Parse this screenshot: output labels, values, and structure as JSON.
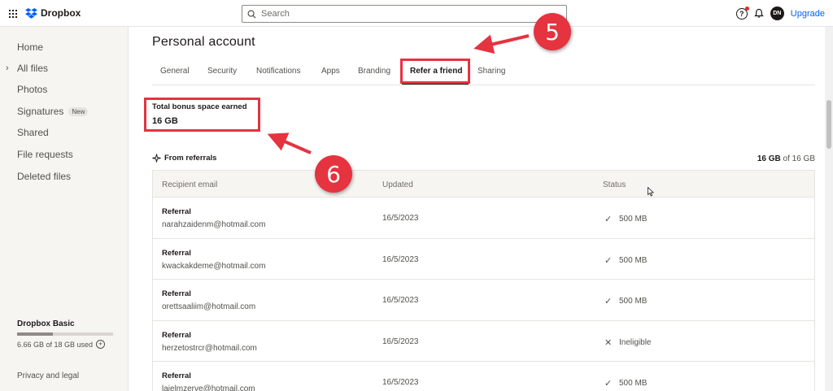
{
  "app": {
    "name": "Dropbox"
  },
  "search": {
    "placeholder": "Search"
  },
  "topbar": {
    "avatar_initials": "DN",
    "upgrade_label": "Upgrade"
  },
  "sidebar": {
    "items": [
      {
        "label": "Home"
      },
      {
        "label": "All files"
      },
      {
        "label": "Photos"
      },
      {
        "label": "Signatures",
        "badge": "New"
      },
      {
        "label": "Shared"
      },
      {
        "label": "File requests"
      },
      {
        "label": "Deleted files"
      }
    ],
    "plan": {
      "title": "Dropbox Basic",
      "usage": "6.66 GB of 18 GB used",
      "used_fraction": 0.37
    },
    "footer": "Privacy and legal"
  },
  "page": {
    "title": "Personal account"
  },
  "tabs": [
    {
      "label": "General"
    },
    {
      "label": "Security"
    },
    {
      "label": "Notifications"
    },
    {
      "label": "Apps"
    },
    {
      "label": "Branding"
    },
    {
      "label": "Refer a friend",
      "active": true
    },
    {
      "label": "Sharing"
    }
  ],
  "bonus": {
    "label": "Total bonus space earned",
    "value": "16 GB"
  },
  "referrals": {
    "header": "From referrals",
    "total_bold": "16 GB",
    "total_rest": " of 16 GB",
    "columns": [
      "Recipient email",
      "Updated",
      "Status"
    ],
    "rows": [
      {
        "type": "Referral",
        "email": "narahzaidenm@hotmail.com",
        "updated": "16/5/2023",
        "status": "500 MB",
        "status_icon": "check-icon"
      },
      {
        "type": "Referral",
        "email": "kwackakdeme@hotmail.com",
        "updated": "16/5/2023",
        "status": "500 MB",
        "status_icon": "check-icon"
      },
      {
        "type": "Referral",
        "email": "orettsaaliim@hotmail.com",
        "updated": "16/5/2023",
        "status": "500 MB",
        "status_icon": "check-icon"
      },
      {
        "type": "Referral",
        "email": "herzetostrcr@hotmail.com",
        "updated": "16/5/2023",
        "status": "Ineligible",
        "status_icon": "x-icon"
      },
      {
        "type": "Referral",
        "email": "laielmzerve@hotmail.com",
        "updated": "16/5/2023",
        "status": "500 MB",
        "status_icon": "check-icon"
      }
    ]
  },
  "annotations": {
    "step5": "5",
    "step6": "6",
    "color": "#e5333f"
  }
}
